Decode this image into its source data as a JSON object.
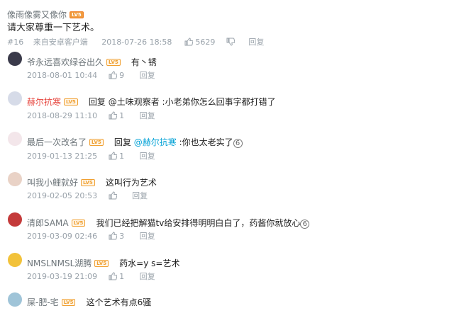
{
  "main": {
    "username": "像雨像雾又像你",
    "level": "LV5",
    "text": "请大家尊重一下艺术。",
    "floor": "#16",
    "source": "来自安卓客户端",
    "time": "2018-07-26 18:58",
    "likes": "5629",
    "reply_label": "回复"
  },
  "replies": [
    {
      "username": "爷永远喜欢绿谷出久",
      "level": "LV5",
      "text": "有丶锈",
      "time": "2018-08-01 10:44",
      "likes": "9",
      "reply_label": "回复"
    },
    {
      "username": "赫尔抗寒",
      "level": "LV5",
      "text": "回复 @土味观察者 :小老弟你怎么回事字都打错了",
      "time": "2018-08-29 11:10",
      "likes": "1",
      "reply_label": "回复"
    },
    {
      "username": "最后一次改名了",
      "level": "LV5",
      "text_prefix": "回复 ",
      "mention": "@赫尔抗寒",
      "text_suffix": " :你也太老实了",
      "time": "2019-01-13 21:25",
      "likes": "1",
      "reply_label": "回复"
    },
    {
      "username": "叫我小鲤就好",
      "level": "LV5",
      "text": "这叫行为艺术",
      "time": "2019-02-05 20:53",
      "likes": "",
      "reply_label": "回复"
    },
    {
      "username": "清郎SAMA",
      "level": "LV5",
      "text": "我们已经把解猫tv给安排得明明白白了，药酱你就放心",
      "time": "2019-03-09 02:46",
      "likes": "3",
      "reply_label": "回复"
    },
    {
      "username": "NMSLNMSL湖腾",
      "level": "LV5",
      "text": "药水=y s=艺术",
      "time": "2019-03-19 21:09",
      "likes": "1",
      "reply_label": "回复"
    },
    {
      "username": "屎-肥-宅",
      "level": "LV5",
      "text": "这个艺术有点6骚",
      "time": "",
      "likes": "",
      "reply_label": ""
    }
  ],
  "colors": {
    "name": "#6d757a",
    "name_red": "#e6433b",
    "meta": "#99a2aa",
    "mention": "#00a1d6",
    "level": "#f0a032"
  }
}
